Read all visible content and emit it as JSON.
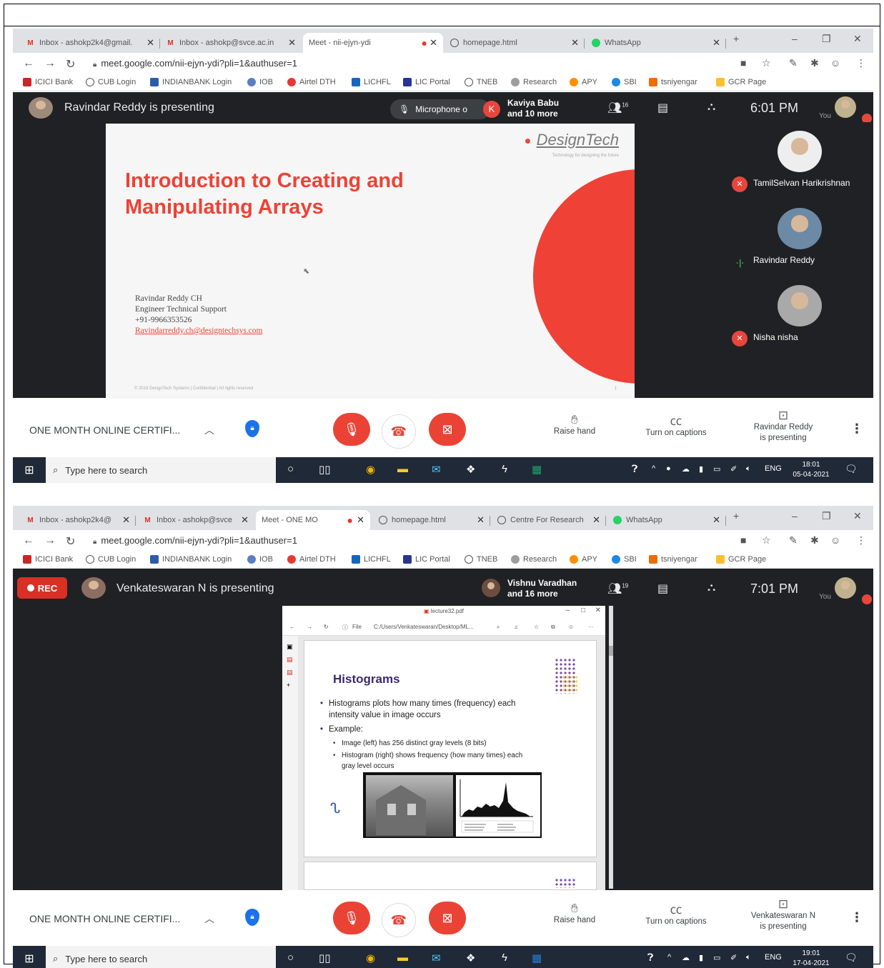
{
  "shots": [
    {
      "tabs": [
        {
          "icon": "gmail-icon",
          "label": "Inbox - ashokp2k4@gmail."
        },
        {
          "icon": "gmail-icon",
          "label": "Inbox - ashokp@svce.ac.in"
        },
        {
          "icon": "meet-icon",
          "label": "Meet - nii-ejyn-ydi",
          "active": true
        },
        {
          "icon": "globe-icon",
          "label": "homepage.html"
        },
        {
          "icon": "whatsapp-icon",
          "label": "WhatsApp"
        }
      ],
      "url": "meet.google.com/nii-ejyn-ydi?pli=1&authuser=1",
      "presenting": "Ravindar Reddy is presenting",
      "microphone_label": "Microphone o",
      "avatar_letter": "K",
      "joiner_name": "Kaviya Babu",
      "joiner_more": "and 10 more",
      "people_count": "16",
      "time": "6:01 PM",
      "you_label": "You",
      "slide": {
        "brand": "DesignTech",
        "tagline": "Technology for designing the future",
        "title_line1": "Introduction to Creating and",
        "title_line2": "Manipulating Arrays",
        "presenter_name": "Ravindar Reddy CH",
        "presenter_role": "Engineer Technical Support",
        "presenter_phone": "+91-9966353526",
        "presenter_email": "Ravindarreddy.ch@designtechsys.com",
        "footer": "© 2018 DesignTech Systems | Confidential | All rights reserved",
        "page_number": "1"
      },
      "participants": [
        {
          "name": "TamilSelvan Harikrishnan",
          "status": "muted"
        },
        {
          "name": "Ravindar Reddy",
          "status": "speaking"
        },
        {
          "name": "Nisha nisha",
          "status": "muted"
        }
      ],
      "meeting_title": "ONE MONTH ONLINE CERTIFI...",
      "raise_hand": "Raise hand",
      "captions": "Turn on captions",
      "presenter_status_line1": "Ravindar Reddy",
      "presenter_status_line2": "is presenting",
      "search_placeholder": "Type here to search",
      "lang": "ENG",
      "clock_time": "18:01",
      "clock_date": "05-04-2021"
    },
    {
      "tabs": [
        {
          "icon": "gmail-icon",
          "label": "Inbox - ashokp2k4@"
        },
        {
          "icon": "gmail-icon",
          "label": "Inbox - ashokp@svce"
        },
        {
          "icon": "meet-icon",
          "label": "Meet - ONE MO",
          "active": true
        },
        {
          "icon": "globe-icon",
          "label": "homepage.html"
        },
        {
          "icon": "globe-icon",
          "label": "Centre For Research"
        },
        {
          "icon": "whatsapp-icon",
          "label": "WhatsApp"
        }
      ],
      "url": "meet.google.com/nii-ejyn-ydi?pli=1&authuser=1",
      "rec_label": "REC",
      "presenting": "Venkateswaran N is presenting",
      "joiner_name": "Vishnu Varadhan",
      "joiner_more": "and 16 more",
      "people_count": "19",
      "time": "7:01 PM",
      "you_label": "You",
      "shared_window": {
        "title": "lecture32.pdf",
        "file_label": "File",
        "file_path": "C:/Users/Venkateswaran/Desktop/ML...",
        "heading": "Histograms",
        "bullet1_line1": "Histograms plots how many times (frequency) each",
        "bullet1_line2": "intensity value in image occurs",
        "bullet2": "Example:",
        "sub1": "Image (left) has 256 distinct gray levels (8 bits)",
        "sub2_line1": "Histogram (right) shows frequency (how many times) each",
        "sub2_line2": "gray level occurs"
      },
      "meeting_title": "ONE MONTH ONLINE CERTIFI...",
      "raise_hand": "Raise hand",
      "captions": "Turn on captions",
      "presenter_status_line1": "Venkateswaran N",
      "presenter_status_line2": "is presenting",
      "search_placeholder": "Type here to search",
      "lang": "ENG",
      "clock_time": "19:01",
      "clock_date": "17-04-2021"
    }
  ],
  "bookmarks": [
    "ICICI Bank",
    "CUB Login",
    "INDIANBANK Login",
    "IOB",
    "Airtel DTH",
    "LICHFL",
    "LIC Portal",
    "TNEB",
    "Research",
    "APY",
    "SBI",
    "tsniyengar",
    "GCR Page"
  ],
  "colors": {
    "meet_bg": "#202124",
    "accent_red": "#ea4335",
    "slide_red": "#ef4136",
    "histogram_purple": "#3b2a6d"
  }
}
